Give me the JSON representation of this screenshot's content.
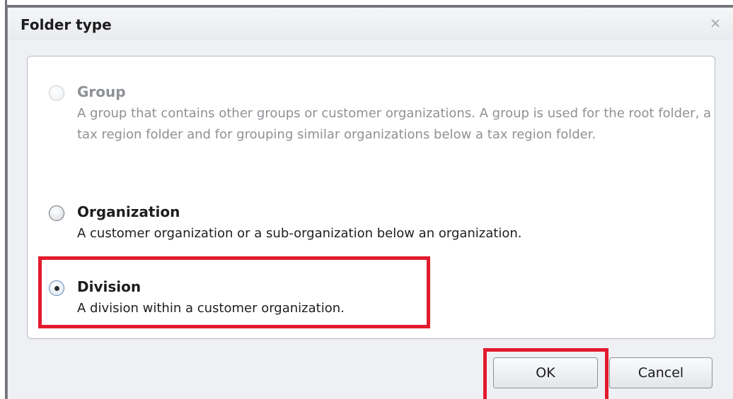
{
  "dialog": {
    "title": "Folder type",
    "close_icon": "close-icon"
  },
  "options": [
    {
      "title": "Group",
      "description": "A group that contains other groups or customer organizations. A group is used for the root folder, a tax region folder and for grouping similar organizations below a tax region folder.",
      "state": "disabled",
      "selected": false
    },
    {
      "title": "Organization",
      "description": "A customer organization or a sub-organization below an organization.",
      "state": "enabled",
      "selected": false
    },
    {
      "title": "Division",
      "description": "A division within a customer organization.",
      "state": "enabled",
      "selected": true
    }
  ],
  "buttons": {
    "ok_label": "OK",
    "cancel_label": "Cancel"
  },
  "colors": {
    "highlight": "#e21a2c",
    "dialog_background": "#eef0f3",
    "disabled_text": "#8e9195"
  }
}
